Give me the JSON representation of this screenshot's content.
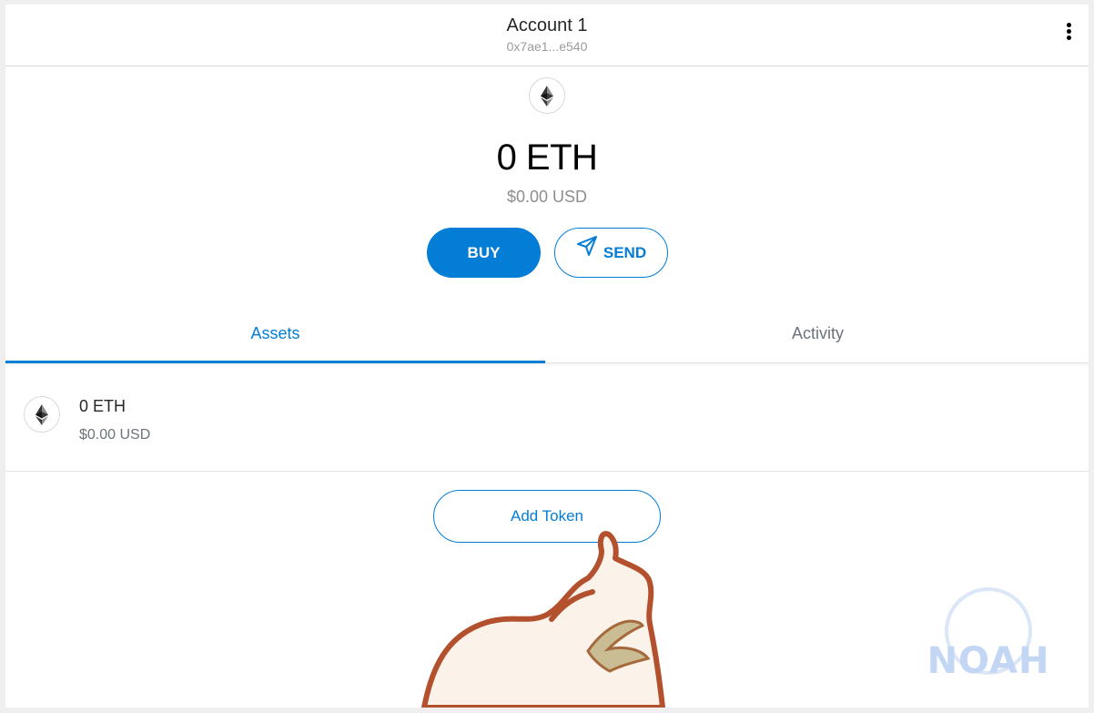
{
  "header": {
    "account_name": "Account 1",
    "account_address": "0x7ae1...e540",
    "menu_icon": "kebab-menu-icon"
  },
  "overview": {
    "token_icon": "ethereum-icon",
    "balance": "0 ETH",
    "fiat_balance": "$0.00 USD",
    "buy_label": "BUY",
    "send_label": "SEND",
    "send_icon": "paper-plane-icon"
  },
  "tabs": [
    {
      "label": "Assets",
      "active": true
    },
    {
      "label": "Activity",
      "active": false
    }
  ],
  "assets": [
    {
      "icon": "ethereum-icon",
      "amount": "0 ETH",
      "fiat": "$0.00 USD"
    }
  ],
  "add_token_label": "Add Token",
  "watermark": {
    "text": "NOAH"
  },
  "colors": {
    "accent": "#037dd6",
    "text_primary": "#24272a",
    "text_secondary": "#6a737d",
    "border": "#d6d9dc"
  }
}
